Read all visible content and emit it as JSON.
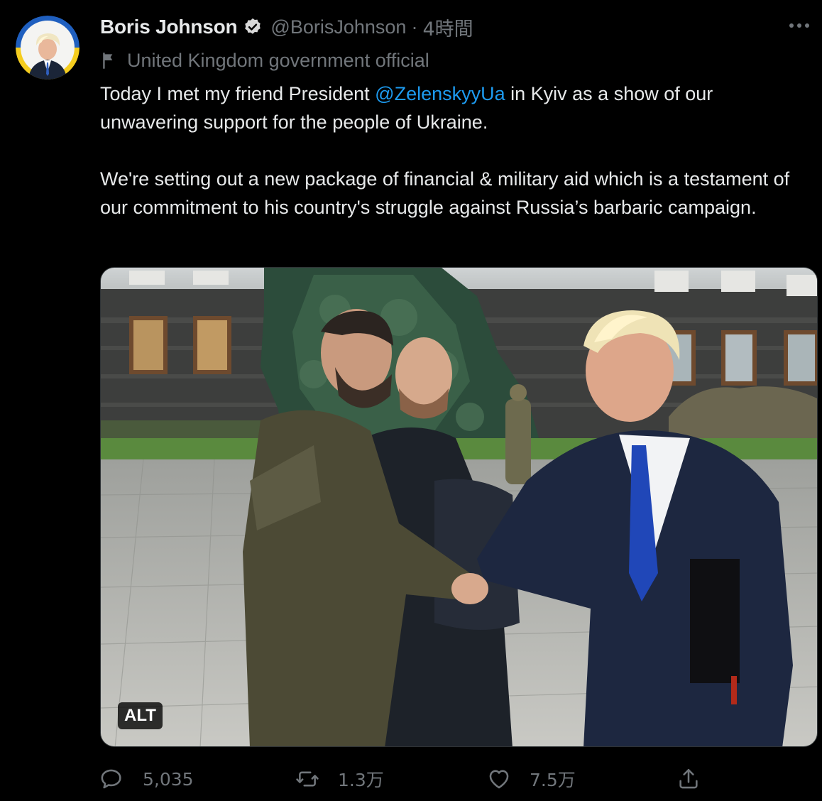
{
  "author": {
    "name": "Boris Johnson",
    "handle": "@BorisJohnson",
    "separator": "·",
    "time": "4時間",
    "label": "United Kingdom government official"
  },
  "tweet": {
    "paragraph1_before": "Today I met my friend President ",
    "mention": "@ZelenskyyUa",
    "paragraph1_after": " in Kyiv as a show of our unwavering support for the people of Ukraine.",
    "paragraph2": "We're setting out a new package of financial & military aid which is a testament of our commitment to his country's struggle against Russia’s barbaric campaign."
  },
  "media": {
    "alt_badge": "ALT"
  },
  "actions": {
    "replies": "5,035",
    "retweets": "1.3万",
    "likes": "7.5万"
  },
  "colors": {
    "background": "#000000",
    "text": "#e7e9ea",
    "secondary": "#71767b",
    "accent": "#1d9bf0"
  },
  "icons": {
    "verified": "verified-badge-icon",
    "more": "more-options-icon",
    "label": "flag-icon",
    "reply": "reply-icon",
    "retweet": "retweet-icon",
    "like": "heart-icon",
    "share": "share-icon"
  }
}
